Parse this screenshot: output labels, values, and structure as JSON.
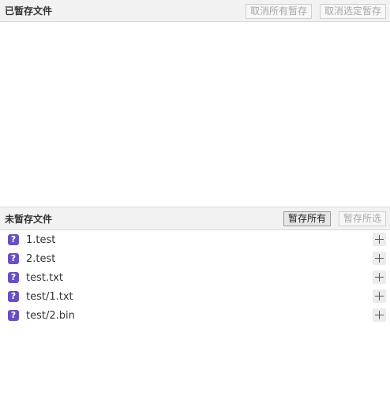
{
  "staged": {
    "title": "已暂存文件",
    "unstage_all_label": "取消所有暂存",
    "unstage_selected_label": "取消选定暂存",
    "files": []
  },
  "unstaged": {
    "title": "未暂存文件",
    "stage_all_label": "暂存所有",
    "stage_selected_label": "暂存所选",
    "files": [
      {
        "name": "1.test",
        "status_icon": "question-mark-icon",
        "status_glyph": "?"
      },
      {
        "name": "2.test",
        "status_icon": "question-mark-icon",
        "status_glyph": "?"
      },
      {
        "name": "test.txt",
        "status_icon": "question-mark-icon",
        "status_glyph": "?"
      },
      {
        "name": "test/1.txt",
        "status_icon": "question-mark-icon",
        "status_glyph": "?"
      },
      {
        "name": "test/2.bin",
        "status_icon": "question-mark-icon",
        "status_glyph": "?"
      }
    ]
  },
  "colors": {
    "untracked_icon_bg": "#6a4fc3",
    "header_bg": "#f2f2f2",
    "disabled_text": "#a8a8a8"
  }
}
